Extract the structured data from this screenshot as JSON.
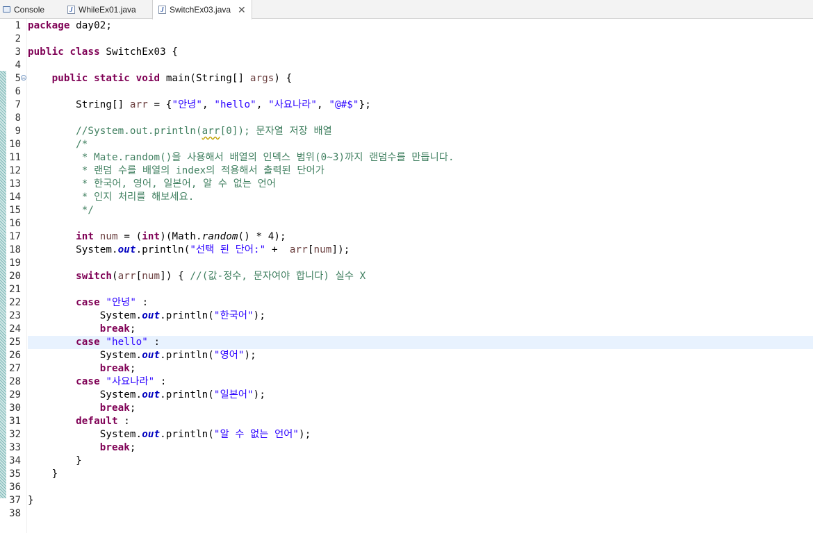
{
  "tabs": [
    {
      "label": "Console",
      "icon": "console-icon",
      "active": false
    },
    {
      "label": "WhileEx01.java",
      "icon": "java-file-icon",
      "active": false
    },
    {
      "label": "SwitchEx03.java",
      "icon": "java-file-icon",
      "active": true,
      "closable": true
    }
  ],
  "editor": {
    "current_line": 25,
    "line_numbers": [
      "1",
      "2",
      "3",
      "4",
      "5",
      "6",
      "7",
      "8",
      "9",
      "10",
      "11",
      "12",
      "13",
      "14",
      "15",
      "16",
      "17",
      "18",
      "19",
      "20",
      "21",
      "22",
      "23",
      "24",
      "25",
      "26",
      "27",
      "28",
      "29",
      "30",
      "31",
      "32",
      "33",
      "34",
      "35",
      "36",
      "37",
      "38"
    ],
    "lines": [
      {
        "n": 1,
        "t": [
          {
            "c": "kw",
            "s": "package"
          },
          {
            "s": " day02;"
          }
        ]
      },
      {
        "n": 2,
        "t": []
      },
      {
        "n": 3,
        "t": [
          {
            "c": "kw",
            "s": "public"
          },
          {
            "s": " "
          },
          {
            "c": "kw",
            "s": "class"
          },
          {
            "s": " SwitchEx03 {"
          }
        ]
      },
      {
        "n": 4,
        "t": []
      },
      {
        "n": 5,
        "fold": true,
        "t": [
          {
            "s": "    "
          },
          {
            "c": "kw",
            "s": "public"
          },
          {
            "s": " "
          },
          {
            "c": "kw",
            "s": "static"
          },
          {
            "s": " "
          },
          {
            "c": "kw",
            "s": "void"
          },
          {
            "s": " main(String[] "
          },
          {
            "c": "var",
            "s": "args"
          },
          {
            "s": ") {"
          }
        ]
      },
      {
        "n": 6,
        "t": []
      },
      {
        "n": 7,
        "t": [
          {
            "s": "        String[] "
          },
          {
            "c": "var",
            "s": "arr"
          },
          {
            "s": " = {"
          },
          {
            "c": "str",
            "s": "\"안녕\""
          },
          {
            "s": ", "
          },
          {
            "c": "str",
            "s": "\"hello\""
          },
          {
            "s": ", "
          },
          {
            "c": "str",
            "s": "\"사요나라\""
          },
          {
            "s": ", "
          },
          {
            "c": "str",
            "s": "\"@#$\""
          },
          {
            "s": "};"
          }
        ]
      },
      {
        "n": 8,
        "t": []
      },
      {
        "n": 9,
        "t": [
          {
            "s": "        "
          },
          {
            "c": "cm",
            "s": "//System.out.println("
          },
          {
            "c": "cm sq",
            "s": "arr"
          },
          {
            "c": "cm",
            "s": "[0]); 문자열 저장 배열"
          }
        ]
      },
      {
        "n": 10,
        "t": [
          {
            "s": "        "
          },
          {
            "c": "cm",
            "s": "/*"
          }
        ]
      },
      {
        "n": 11,
        "t": [
          {
            "s": "        "
          },
          {
            "c": "cm",
            "s": " * Mate.random()을 사용해서 배열의 인덱스 범위(0~3)까지 랜덤수를 만듭니다."
          }
        ]
      },
      {
        "n": 12,
        "t": [
          {
            "s": "        "
          },
          {
            "c": "cm",
            "s": " * 랜덤 수를 배열의 index의 적용해서 출력된 단어가"
          }
        ]
      },
      {
        "n": 13,
        "t": [
          {
            "s": "        "
          },
          {
            "c": "cm",
            "s": " * 한국어, 영어, 일본어, 알 수 없는 언어"
          }
        ]
      },
      {
        "n": 14,
        "t": [
          {
            "s": "        "
          },
          {
            "c": "cm",
            "s": " * 인지 처리를 해보세요."
          }
        ]
      },
      {
        "n": 15,
        "t": [
          {
            "s": "        "
          },
          {
            "c": "cm",
            "s": " */"
          }
        ]
      },
      {
        "n": 16,
        "t": []
      },
      {
        "n": 17,
        "t": [
          {
            "s": "        "
          },
          {
            "c": "kw",
            "s": "int"
          },
          {
            "s": " "
          },
          {
            "c": "var",
            "s": "num"
          },
          {
            "s": " = ("
          },
          {
            "c": "kw",
            "s": "int"
          },
          {
            "s": ")(Math."
          },
          {
            "c": "st",
            "s": "random"
          },
          {
            "s": "() * 4);"
          }
        ]
      },
      {
        "n": 18,
        "t": [
          {
            "s": "        System."
          },
          {
            "c": "fld",
            "s": "out"
          },
          {
            "s": ".println("
          },
          {
            "c": "str",
            "s": "\"선택 된 단어:\""
          },
          {
            "s": " +  "
          },
          {
            "c": "var",
            "s": "arr"
          },
          {
            "s": "["
          },
          {
            "c": "var",
            "s": "num"
          },
          {
            "s": "]);"
          }
        ]
      },
      {
        "n": 19,
        "t": []
      },
      {
        "n": 20,
        "t": [
          {
            "s": "        "
          },
          {
            "c": "kw",
            "s": "switch"
          },
          {
            "s": "("
          },
          {
            "c": "var",
            "s": "arr"
          },
          {
            "s": "["
          },
          {
            "c": "var",
            "s": "num"
          },
          {
            "s": "]) { "
          },
          {
            "c": "cm",
            "s": "//(값-정수, 문자여야 합니다) 실수 X"
          }
        ]
      },
      {
        "n": 21,
        "t": []
      },
      {
        "n": 22,
        "t": [
          {
            "s": "        "
          },
          {
            "c": "kw",
            "s": "case"
          },
          {
            "s": " "
          },
          {
            "c": "str",
            "s": "\"안녕\""
          },
          {
            "s": " :"
          }
        ]
      },
      {
        "n": 23,
        "t": [
          {
            "s": "            System."
          },
          {
            "c": "fld",
            "s": "out"
          },
          {
            "s": ".println("
          },
          {
            "c": "str",
            "s": "\"한국어\""
          },
          {
            "s": ");"
          }
        ]
      },
      {
        "n": 24,
        "t": [
          {
            "s": "            "
          },
          {
            "c": "kw",
            "s": "break"
          },
          {
            "s": ";"
          }
        ]
      },
      {
        "n": 25,
        "t": [
          {
            "s": "        "
          },
          {
            "c": "kw",
            "s": "case"
          },
          {
            "s": " "
          },
          {
            "c": "str",
            "s": "\"hello\""
          },
          {
            "s": " :"
          }
        ]
      },
      {
        "n": 26,
        "t": [
          {
            "s": "            System."
          },
          {
            "c": "fld",
            "s": "out"
          },
          {
            "s": ".println("
          },
          {
            "c": "str",
            "s": "\"영어\""
          },
          {
            "s": ");"
          }
        ]
      },
      {
        "n": 27,
        "t": [
          {
            "s": "            "
          },
          {
            "c": "kw",
            "s": "break"
          },
          {
            "s": ";"
          }
        ]
      },
      {
        "n": 28,
        "t": [
          {
            "s": "        "
          },
          {
            "c": "kw",
            "s": "case"
          },
          {
            "s": " "
          },
          {
            "c": "str",
            "s": "\"사요나라\""
          },
          {
            "s": " :"
          }
        ]
      },
      {
        "n": 29,
        "t": [
          {
            "s": "            System."
          },
          {
            "c": "fld",
            "s": "out"
          },
          {
            "s": ".println("
          },
          {
            "c": "str",
            "s": "\"일본어\""
          },
          {
            "s": ");"
          }
        ]
      },
      {
        "n": 30,
        "t": [
          {
            "s": "            "
          },
          {
            "c": "kw",
            "s": "break"
          },
          {
            "s": ";"
          }
        ]
      },
      {
        "n": 31,
        "t": [
          {
            "s": "        "
          },
          {
            "c": "kw",
            "s": "default"
          },
          {
            "s": " :"
          }
        ]
      },
      {
        "n": 32,
        "t": [
          {
            "s": "            System."
          },
          {
            "c": "fld",
            "s": "out"
          },
          {
            "s": ".println("
          },
          {
            "c": "str",
            "s": "\"알 수 없는 언어\""
          },
          {
            "s": ");"
          }
        ]
      },
      {
        "n": 33,
        "t": [
          {
            "s": "            "
          },
          {
            "c": "kw",
            "s": "break"
          },
          {
            "s": ";"
          }
        ]
      },
      {
        "n": 34,
        "t": [
          {
            "s": "        }"
          }
        ]
      },
      {
        "n": 35,
        "t": [
          {
            "s": "    }"
          }
        ]
      },
      {
        "n": 36,
        "t": []
      },
      {
        "n": 37,
        "t": [
          {
            "s": "}"
          }
        ]
      },
      {
        "n": 38,
        "t": []
      }
    ]
  },
  "colors": {
    "keyword": "#7f0055",
    "string": "#2a00ff",
    "comment": "#3f7f5f",
    "static_field": "#0000c0",
    "local_variable": "#6a3e3e",
    "current_line_highlight": "#e8f2fe"
  }
}
